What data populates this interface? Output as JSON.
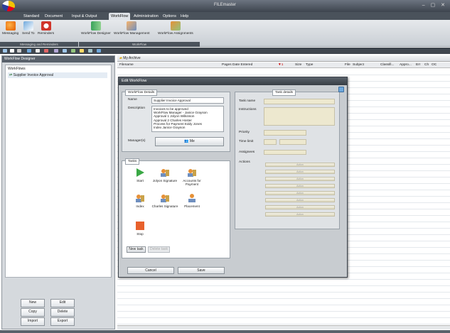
{
  "app": {
    "title": "FILEmaster"
  },
  "menu": {
    "tabs": [
      "Standard",
      "Document",
      "Input & Output",
      "WorkFlow",
      "Administration",
      "Options",
      "Help"
    ],
    "active": "WorkFlow"
  },
  "ribbon": {
    "buttons": [
      "Messaging",
      "Send To",
      "Reminders",
      "WorkFlow Designer",
      "WorkFlow Management",
      "WorkFlow Assignments"
    ],
    "groups": [
      "Messaging and Reminders",
      "WorkFlow"
    ]
  },
  "left_panel": {
    "header": "WorkFlow Designer",
    "tree_root": "WorkFlows",
    "tree_item": "Supplier Invoice Approval",
    "buttons": {
      "new": "New",
      "edit": "Edit",
      "copy": "Copy",
      "delete": "Delete",
      "import": "Import",
      "export": "Export"
    }
  },
  "doc_list": {
    "folder": "My Archive",
    "columns": [
      "Filename",
      "Pages",
      "Date Entered",
      "Size",
      "Type",
      "File",
      "Subject",
      "Classifi...",
      "Appro...",
      "Err",
      "Ch",
      "OC"
    ]
  },
  "dialog": {
    "title": "Edit WorkFlow",
    "details_legend": "WorkFlow Details",
    "name_label": "Name",
    "name_value": "Supplier Invoice Approval",
    "description_label": "Description",
    "description_lines": [
      "Invoices to be approved",
      "WorkFlow Manager - Janice Grayson",
      "Approval 1 Jolyon Wilkinson",
      "Approval 2 Charles Hoster",
      "Process for Payment Eddy Jones",
      "Index Janice Grayson"
    ],
    "managers_label": "Manager(s)",
    "managers_value": "Me",
    "tasks_legend": "Tasks",
    "tasks": [
      "Start",
      "Jolyon Signature",
      "Accounts for Payment",
      "Index",
      "Charles Signature",
      "Placement",
      "Stop"
    ],
    "new_task": "New task",
    "delete_task": "Delete task",
    "cancel": "Cancel",
    "save": "Save",
    "task_details_legend": "Task details",
    "task_name_label": "Task name",
    "instructions_label": "Instructions",
    "priority_label": "Priority",
    "timelimit_label": "Time limit",
    "assignees_label": "Assignees",
    "actions_label": "Actions",
    "action_button_label": "Action"
  }
}
